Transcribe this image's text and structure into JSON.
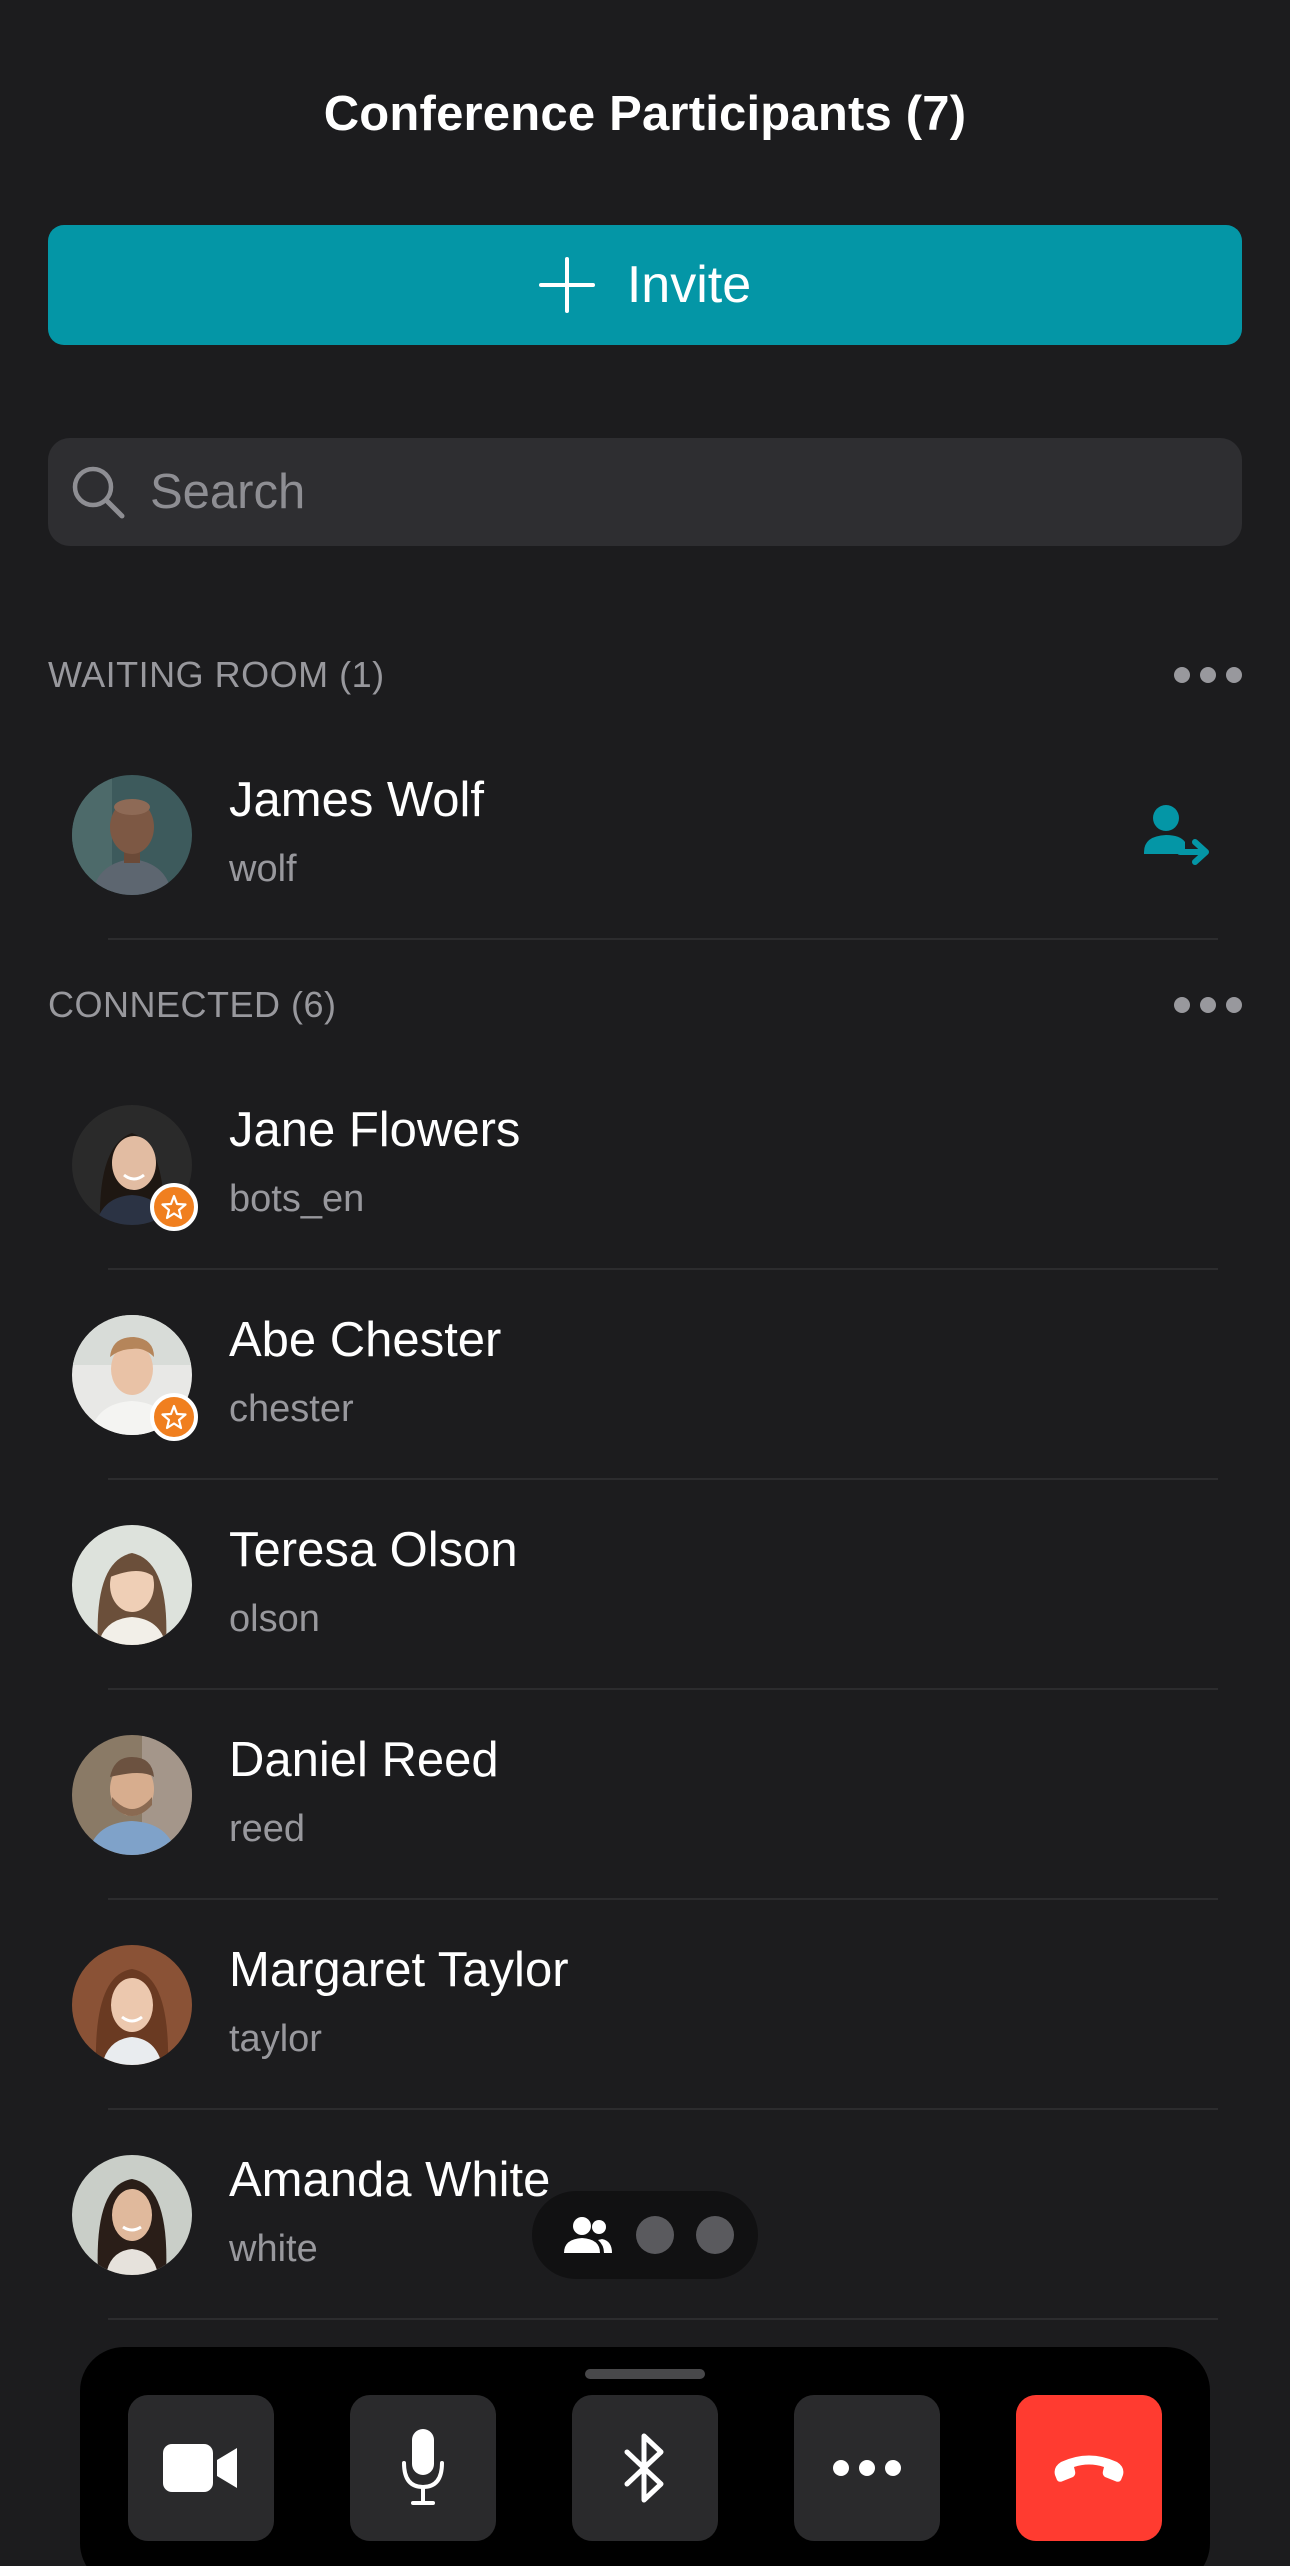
{
  "header": {
    "title": "Conference Participants (7)"
  },
  "invite": {
    "label": "Invite",
    "icon": "plus-icon"
  },
  "search": {
    "placeholder": "Search",
    "value": "",
    "icon": "search-icon"
  },
  "waiting_room": {
    "title": "WAITING ROOM (1)",
    "participants": [
      {
        "name": "James Wolf",
        "username": "wolf",
        "action_icon": "admit-user-icon"
      }
    ]
  },
  "connected": {
    "title": "CONNECTED (6)",
    "participants": [
      {
        "name": "Jane Flowers",
        "username": "bots_en",
        "moderator": true
      },
      {
        "name": "Abe Chester",
        "username": "chester",
        "moderator": true
      },
      {
        "name": "Teresa Olson",
        "username": "olson",
        "moderator": false
      },
      {
        "name": "Daniel Reed",
        "username": "reed",
        "moderator": false
      },
      {
        "name": "Margaret Taylor",
        "username": "taylor",
        "moderator": false
      },
      {
        "name": "Amanda White",
        "username": "white",
        "moderator": false
      }
    ]
  },
  "pager": {
    "pages": 3,
    "current": 1,
    "icon": "participants-icon"
  },
  "toolbar": {
    "buttons": [
      "video-camera-icon",
      "microphone-icon",
      "bluetooth-icon",
      "more-icon",
      "end-call-icon"
    ]
  },
  "colors": {
    "background": "#1c1c1e",
    "accent": "#0496a6",
    "moderator_badge": "#f07f1f",
    "end_call": "#ff3b30"
  }
}
